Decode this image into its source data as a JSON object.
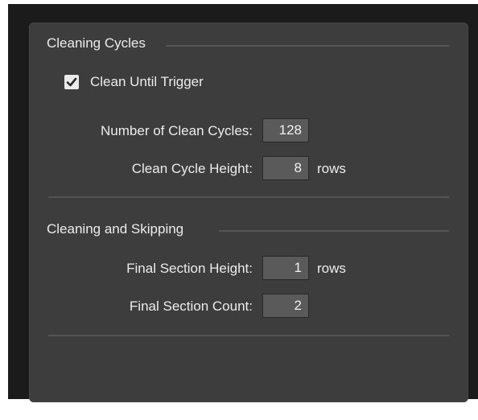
{
  "sections": {
    "cleaning_cycles": {
      "title": "Cleaning Cycles",
      "clean_until_trigger": {
        "label": "Clean Until Trigger",
        "checked": true
      },
      "number_of_clean_cycles": {
        "label": "Number of Clean Cycles:",
        "value": "128"
      },
      "clean_cycle_height": {
        "label": "Clean Cycle Height:",
        "value": "8",
        "unit": "rows"
      }
    },
    "cleaning_and_skipping": {
      "title": "Cleaning and Skipping",
      "final_section_height": {
        "label": "Final Section Height:",
        "value": "1",
        "unit": "rows"
      },
      "final_section_count": {
        "label": "Final Section Count:",
        "value": "2"
      }
    }
  },
  "icons": {
    "checkbox_mark": "checkmark-icon"
  },
  "colors": {
    "panel": "#3d3d3d",
    "field": "#5a5a5a",
    "text": "#ececec"
  }
}
